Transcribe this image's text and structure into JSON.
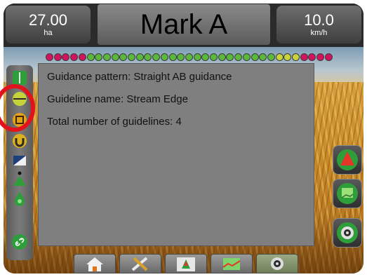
{
  "top_bar": {
    "area": {
      "value": "27.00",
      "unit": "ha"
    },
    "title": "Mark A",
    "speed": {
      "value": "10.0",
      "unit": "km/h"
    }
  },
  "info_panel": {
    "lines": [
      "Guidance pattern: Straight AB guidance",
      "Guideline name: Stream Edge",
      "Total number of guidelines: 4"
    ]
  },
  "lightbar": {
    "colors": [
      "#d3135d",
      "#d3135d",
      "#d3135d",
      "#d3135d",
      "#d3135d",
      "#5ab83a",
      "#5ab83a",
      "#5ab83a",
      "#5ab83a",
      "#5ab83a",
      "#5ab83a",
      "#5ab83a",
      "#5ab83a",
      "#5ab83a",
      "#5ab83a",
      "#5ab83a",
      "#5ab83a",
      "#5ab83a",
      "#5ab83a",
      "#5ab83a",
      "#5ab83a",
      "#5ab83a",
      "#5ab83a",
      "#5ab83a",
      "#5ab83a",
      "#5ab83a",
      "#5ab83a",
      "#5ab83a",
      "#c8d43a",
      "#c8d43a",
      "#c8d43a",
      "#d3135d",
      "#d3135d",
      "#d3135d",
      "#d3135d"
    ]
  },
  "left_toolbar": {
    "items": [
      "guideline-icon",
      "marked-point-icon",
      "boundary-icon",
      "magnet-icon",
      "tilt-icon",
      "guidance-arrow-icon",
      "droplet-icon",
      "link-icon"
    ]
  },
  "right_toolbar": {
    "items": [
      "view-orientation-icon",
      "guidance-mode-icon",
      "screen-options-icon"
    ]
  },
  "bottom_tabs": {
    "items": [
      "home-icon",
      "tools-icon",
      "guidance-icon",
      "map-icon",
      "camera-icon"
    ],
    "active": "camera-icon"
  },
  "colors": {
    "accent_green": "#2e9e3a",
    "callout_red": "#e1141e"
  }
}
